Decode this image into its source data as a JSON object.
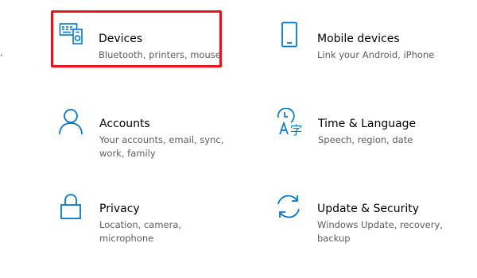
{
  "accent_color": "#0078d7",
  "highlight_color": "#e8141d",
  "edge_mark": ",",
  "tiles": [
    {
      "title": "Devices",
      "description": "Bluetooth, printers, mouse",
      "icon": "devices-icon"
    },
    {
      "title": "Mobile devices",
      "description": "Link your Android, iPhone",
      "icon": "mobile-phone-icon"
    },
    {
      "title": "Accounts",
      "description": "Your accounts, email, sync, work, family",
      "icon": "person-icon"
    },
    {
      "title": "Time & Language",
      "description": "Speech, region, date",
      "icon": "time-language-icon"
    },
    {
      "title": "Privacy",
      "description": "Location, camera, microphone",
      "icon": "lock-icon"
    },
    {
      "title": "Update & Security",
      "description": "Windows Update, recovery, backup",
      "icon": "sync-arrows-icon"
    }
  ]
}
